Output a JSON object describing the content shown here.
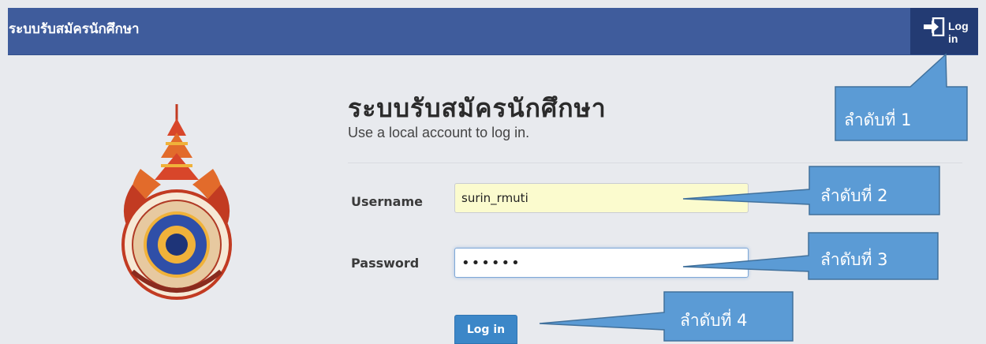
{
  "header": {
    "brand": "ระบบรับสมัครนักศึกษา",
    "login_link": "Log in",
    "login_icon": "sign-in-icon"
  },
  "logo": {
    "icon": "university-seal"
  },
  "main": {
    "title": "ระบบรับสมัครนักศึกษา",
    "subtitle": "Use a local account to log in.",
    "username_label": "Username",
    "username_value": "surin_rmuti",
    "password_label": "Password",
    "password_value": "••••••",
    "submit_label": "Log in"
  },
  "callouts": [
    "ลำดับที่ 1",
    "ลำดับที่ 2",
    "ลำดับที่ 3",
    "ลำดับที่ 4"
  ],
  "colors": {
    "navbar": "#3f5c9c",
    "navbar_active": "#233b73",
    "callout_fill": "#5b9bd5",
    "callout_stroke": "#41719c",
    "button": "#3c87c8",
    "autofill": "#fbfbce"
  }
}
